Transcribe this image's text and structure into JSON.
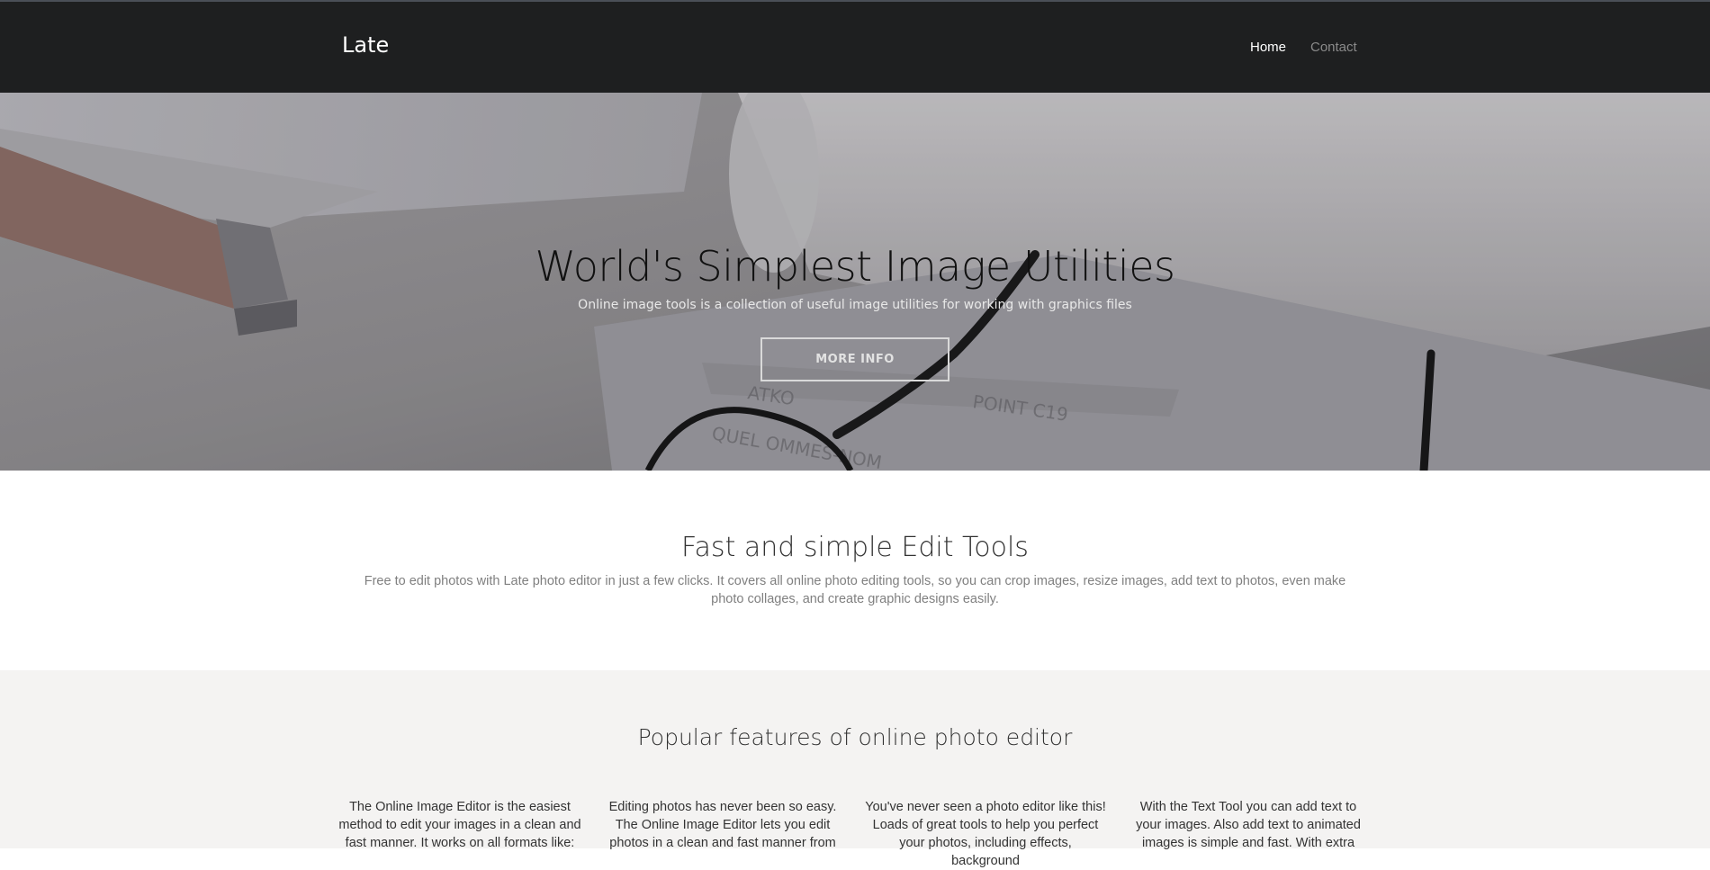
{
  "header": {
    "brand": "Late",
    "nav": [
      {
        "label": "Home",
        "active": true
      },
      {
        "label": "Contact",
        "active": false
      }
    ]
  },
  "hero": {
    "title": "World's Simplest Image Utilities",
    "subtitle": "Online image tools is a collection of useful image utilities for working with graphics files",
    "button_label": "MORE INFO"
  },
  "tools": {
    "title": "Fast and simple Edit Tools",
    "text": "Free to edit photos with Late photo editor in just a few clicks. It covers all online photo editing tools, so you can crop images, resize images, add text to photos, even make photo collages, and create graphic designs easily."
  },
  "features": {
    "title": "Popular features of online photo editor",
    "columns": [
      {
        "text": "The Online Image Editor is the easiest method to edit your images in a clean and fast manner. It works on all formats like:"
      },
      {
        "text": "Editing photos has never been so easy. The Online Image Editor lets you edit photos in a clean and fast manner from"
      },
      {
        "text": "You've never seen a photo editor like this! Loads of great tools to help you perfect your photos, including effects, background"
      },
      {
        "text": "With the Text Tool you can add text to your images. Also add text to animated images is simple and fast. With extra"
      }
    ]
  },
  "colors": {
    "navbar_bg": "#1e1f20",
    "features_bg": "#f4f3f2",
    "muted_text": "#808080"
  }
}
